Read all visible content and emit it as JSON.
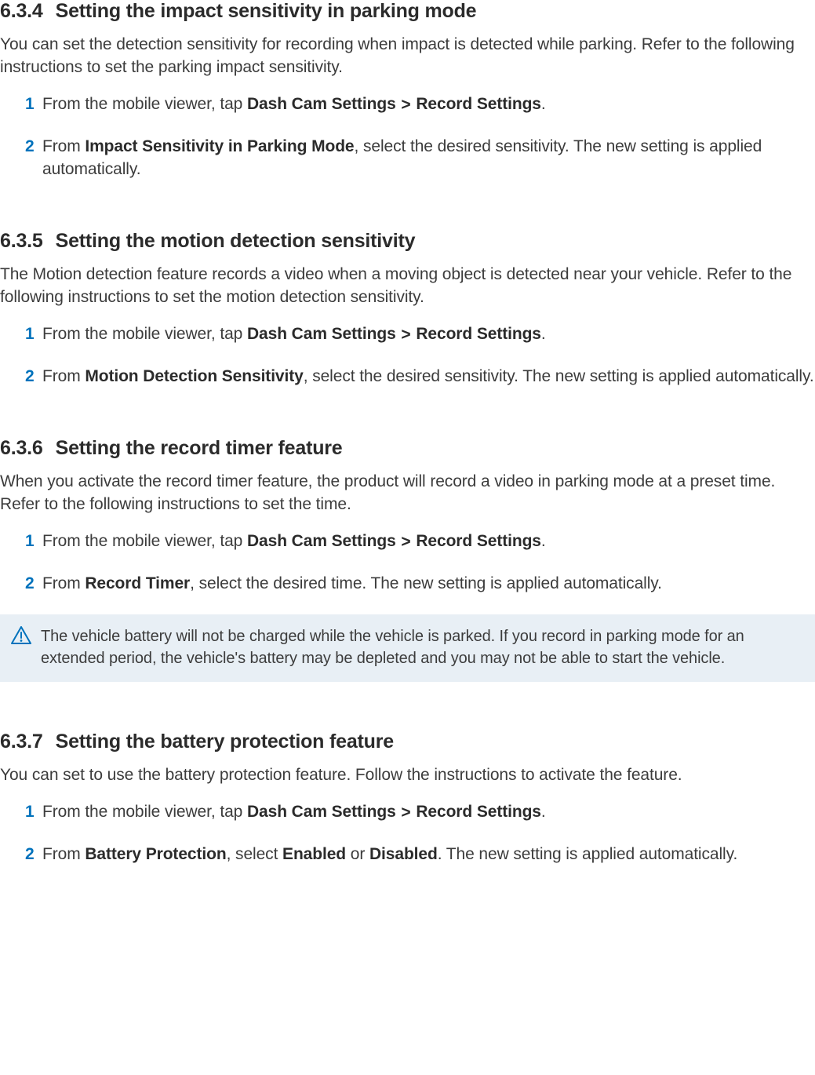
{
  "sections": [
    {
      "num": "6.3.4",
      "title": "Setting the impact sensitivity in parking mode",
      "intro": "You can set the detection sensitivity for recording when impact is detected while parking. Refer to the following instructions to set the parking impact sensitivity.",
      "steps": [
        {
          "n": "1",
          "pre": "From the mobile viewer, tap ",
          "bold1": "Dash Cam Settings",
          "sep": ">",
          "bold2": "Record Settings",
          "post": "."
        },
        {
          "n": "2",
          "pre": "From ",
          "bold1": "Impact Sensitivity in Parking Mode",
          "post": ", select the desired sensitivity. The new setting is applied automatically."
        }
      ]
    },
    {
      "num": "6.3.5",
      "title": "Setting the motion detection sensitivity",
      "intro": "The Motion detection feature records a video when a moving object is detected near your vehicle. Refer to the following instructions to set the motion detection sensitivity.",
      "steps": [
        {
          "n": "1",
          "pre": "From the mobile viewer, tap ",
          "bold1": "Dash Cam Settings",
          "sep": ">",
          "bold2": "Record Settings",
          "post": "."
        },
        {
          "n": "2",
          "pre": "From ",
          "bold1": "Motion Detection Sensitivity",
          "post": ", select the desired sensitivity. The new setting is applied automatically."
        }
      ]
    },
    {
      "num": "6.3.6",
      "title": "Setting the record timer feature",
      "intro": "When you activate the record timer feature, the product will record a video in parking mode at a preset time. Refer to the following instructions to set the time.",
      "steps": [
        {
          "n": "1",
          "pre": "From the mobile viewer, tap ",
          "bold1": "Dash Cam Settings",
          "sep": ">",
          "bold2": "Record Settings",
          "post": "."
        },
        {
          "n": "2",
          "pre": "From ",
          "bold1": "Record Timer",
          "post": ", select the desired time. The new setting is applied automatically."
        }
      ],
      "callout": "The vehicle battery will not be charged while the vehicle is parked. If you record in parking mode for an extended period, the vehicle's battery may be depleted and you may not be able to start the vehicle."
    },
    {
      "num": "6.3.7",
      "title": "Setting the battery protection feature",
      "intro": "You can set to use the battery protection feature. Follow the instructions to activate the feature.",
      "steps": [
        {
          "n": "1",
          "pre": "From the mobile viewer, tap ",
          "bold1": "Dash Cam Settings",
          "sep": ">",
          "bold2": "Record Settings",
          "post": "."
        },
        {
          "n": "2",
          "pre": "From ",
          "bold1": "Battery Protection",
          "post_a": ", select ",
          "bold_b": "Enabled",
          "post_b": " or ",
          "bold_c": "Disabled",
          "post_c": ". The new setting is applied automatically."
        }
      ]
    }
  ],
  "icon_name": "warning-icon"
}
